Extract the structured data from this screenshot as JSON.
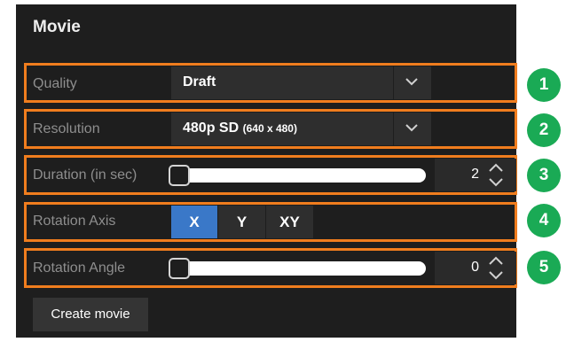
{
  "panel": {
    "title": "Movie"
  },
  "quality": {
    "label": "Quality",
    "value": "Draft"
  },
  "resolution": {
    "label": "Resolution",
    "value": "480p SD",
    "detail": "(640 x 480)"
  },
  "duration": {
    "label": "Duration (in sec)",
    "value": "2",
    "slider_fraction": 0.0
  },
  "rotation_axis": {
    "label": "Rotation Axis",
    "options": [
      "X",
      "Y",
      "XY"
    ],
    "selected": "X"
  },
  "rotation_angle": {
    "label": "Rotation Angle",
    "value": "0",
    "slider_fraction": 0.0
  },
  "create_button": {
    "label": "Create movie"
  },
  "badges": [
    "1",
    "2",
    "3",
    "4",
    "5"
  ],
  "colors": {
    "panel_bg": "#1e1e1e",
    "highlight": "#f07d1e",
    "badge": "#1aaa55",
    "selected": "#3a78c8"
  }
}
